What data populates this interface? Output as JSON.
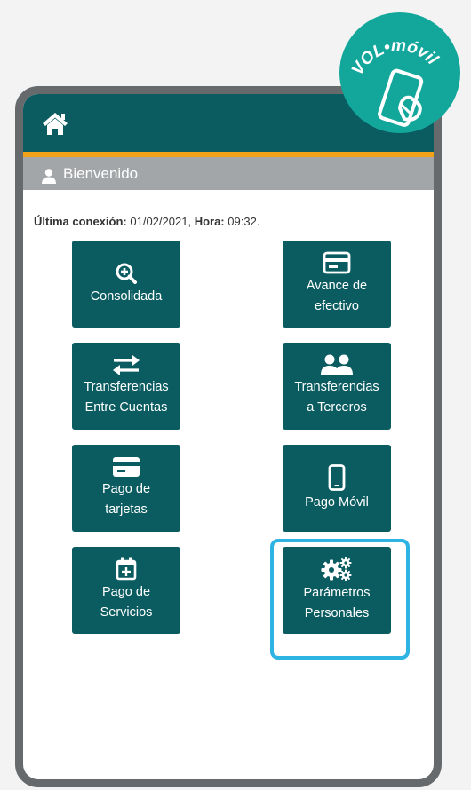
{
  "welcome": {
    "text": "Bienvenido"
  },
  "last_connection": {
    "label": "Última conexión:",
    "date": "01/02/2021",
    "time_label": "Hora:",
    "time": "09:32."
  },
  "tiles": [
    {
      "line1": "Consolidada",
      "line2": "",
      "icon": "zoom-in-icon"
    },
    {
      "line1": "Avance de",
      "line2": "efectivo",
      "icon": "credit-card-icon"
    },
    {
      "line1": "Transferencias",
      "line2": "Entre Cuentas",
      "icon": "arrows-exchange-icon"
    },
    {
      "line1": "Transferencias",
      "line2": "a Terceros",
      "icon": "users-icon"
    },
    {
      "line1": "Pago de",
      "line2": "tarjetas",
      "icon": "credit-card-icon"
    },
    {
      "line1": "Pago Móvil",
      "line2": "",
      "icon": "mobile-phone-icon"
    },
    {
      "line1": "Pago de",
      "line2": "Servicios",
      "icon": "calendar-plus-icon"
    },
    {
      "line1": "Parámetros",
      "line2": "Personales",
      "icon": "gears-icon"
    }
  ],
  "badge": {
    "brand": "VOL",
    "dot": "•",
    "product": "móvil"
  },
  "colors": {
    "primary": "#0b5c61",
    "accent": "#f2a218",
    "highlight": "#2db4e3",
    "badge": "#13a79b",
    "frame": "#666a6d"
  }
}
